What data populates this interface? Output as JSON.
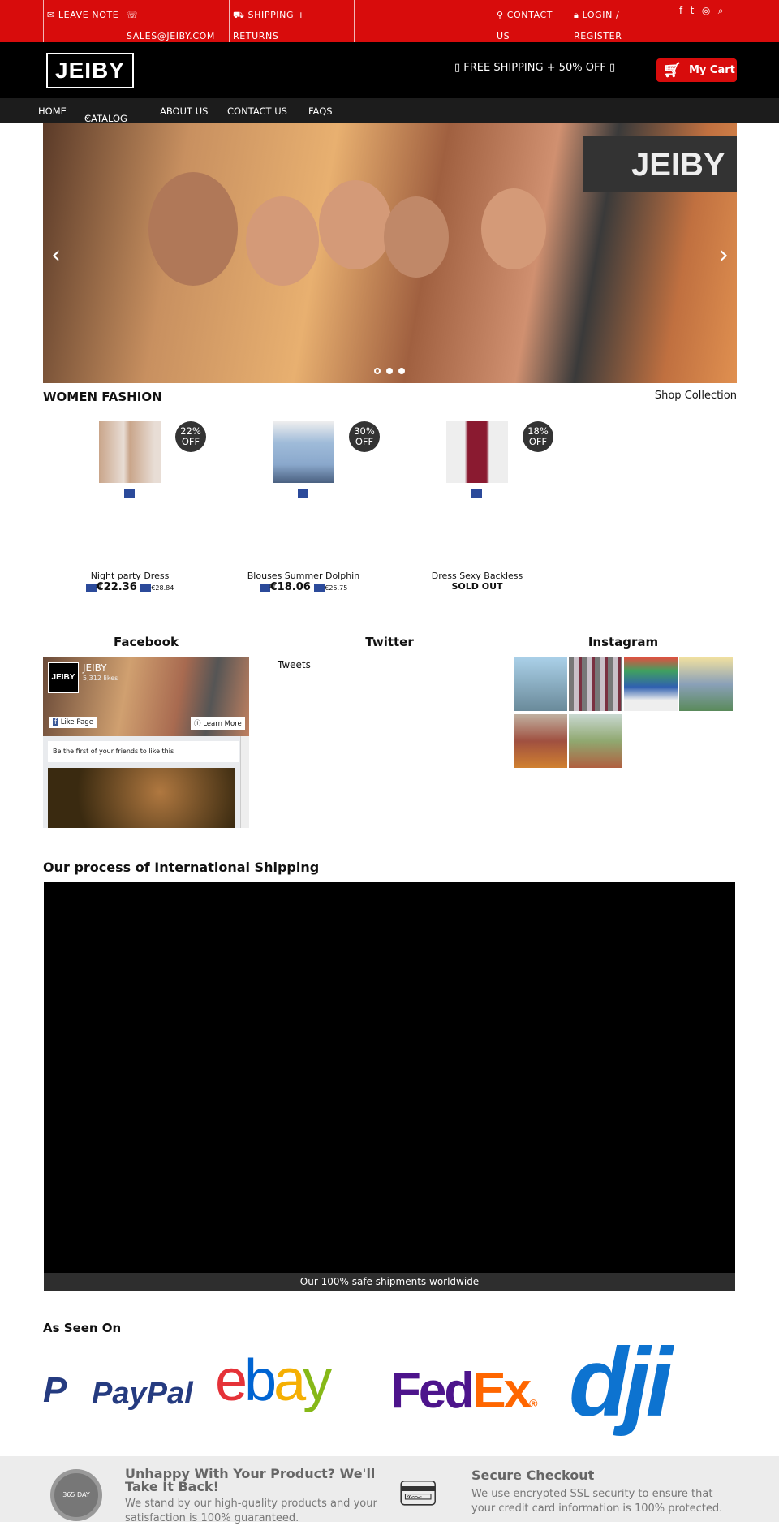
{
  "topbar": {
    "leave_note": "LEAVE NOTE",
    "email": "SALES@JEIBY.COM",
    "shipping": "SHIPPING + RETURNS",
    "contact": "CONTACT US",
    "login": "LOGIN / REGISTER",
    "icons": [
      "facebook-icon",
      "twitter-icon",
      "instagram-icon",
      "search-icon"
    ]
  },
  "header": {
    "logo": "JEIBY",
    "promo": "▯ FREE SHIPPING + 50% OFF ▯",
    "cart": "My Cart"
  },
  "nav": {
    "items": [
      "HOME",
      "CATALOG",
      "ABOUT US",
      "CONTACT US",
      "FAQS"
    ]
  },
  "hero": {
    "slide_count": 3,
    "active_slide": 1
  },
  "women": {
    "title": "WOMEN FASHION",
    "link": "Shop Collection",
    "products": [
      {
        "name": "Night party Dress",
        "badge1": "22%",
        "badge2": "OFF",
        "price": "€22.36",
        "old_price": "€28.84"
      },
      {
        "name": "Blouses Summer Dolphin",
        "badge1": "30%",
        "badge2": "OFF",
        "price": "€18.06",
        "old_price": "€25.75"
      },
      {
        "name": "Dress Sexy Backless",
        "badge1": "18%",
        "badge2": "OFF",
        "status": "SOLD OUT"
      }
    ]
  },
  "social": {
    "facebook": "Facebook",
    "twitter": "Twitter",
    "instagram": "Instagram",
    "fb_page": "JEIBY",
    "fb_likes": "5,312 likes",
    "fb_like": "Like Page",
    "fb_learn": "Learn More",
    "fb_friends": "Be the first of your friends to like this",
    "tweets": "Tweets"
  },
  "shipping": {
    "title": "Our process of International Shipping",
    "caption": "Our 100% safe shipments worldwide"
  },
  "seen": {
    "title": "As Seen On",
    "paypal": "PayPal",
    "ebay": "ebay",
    "fedex_fed": "Fed",
    "fedex_ex": "Ex",
    "dji": "dji"
  },
  "footer": {
    "t1": "Unhappy With Your Product? We'll Take It Back!",
    "p1": "We stand by our high-quality products and your satisfaction is 100% guaranteed.",
    "seal": "365 DAY",
    "t2": "Secure Checkout",
    "p2": "We use encrypted SSL security to ensure that your credit card information is 100% protected."
  },
  "colors": {
    "brand_red": "#d80c0c"
  }
}
